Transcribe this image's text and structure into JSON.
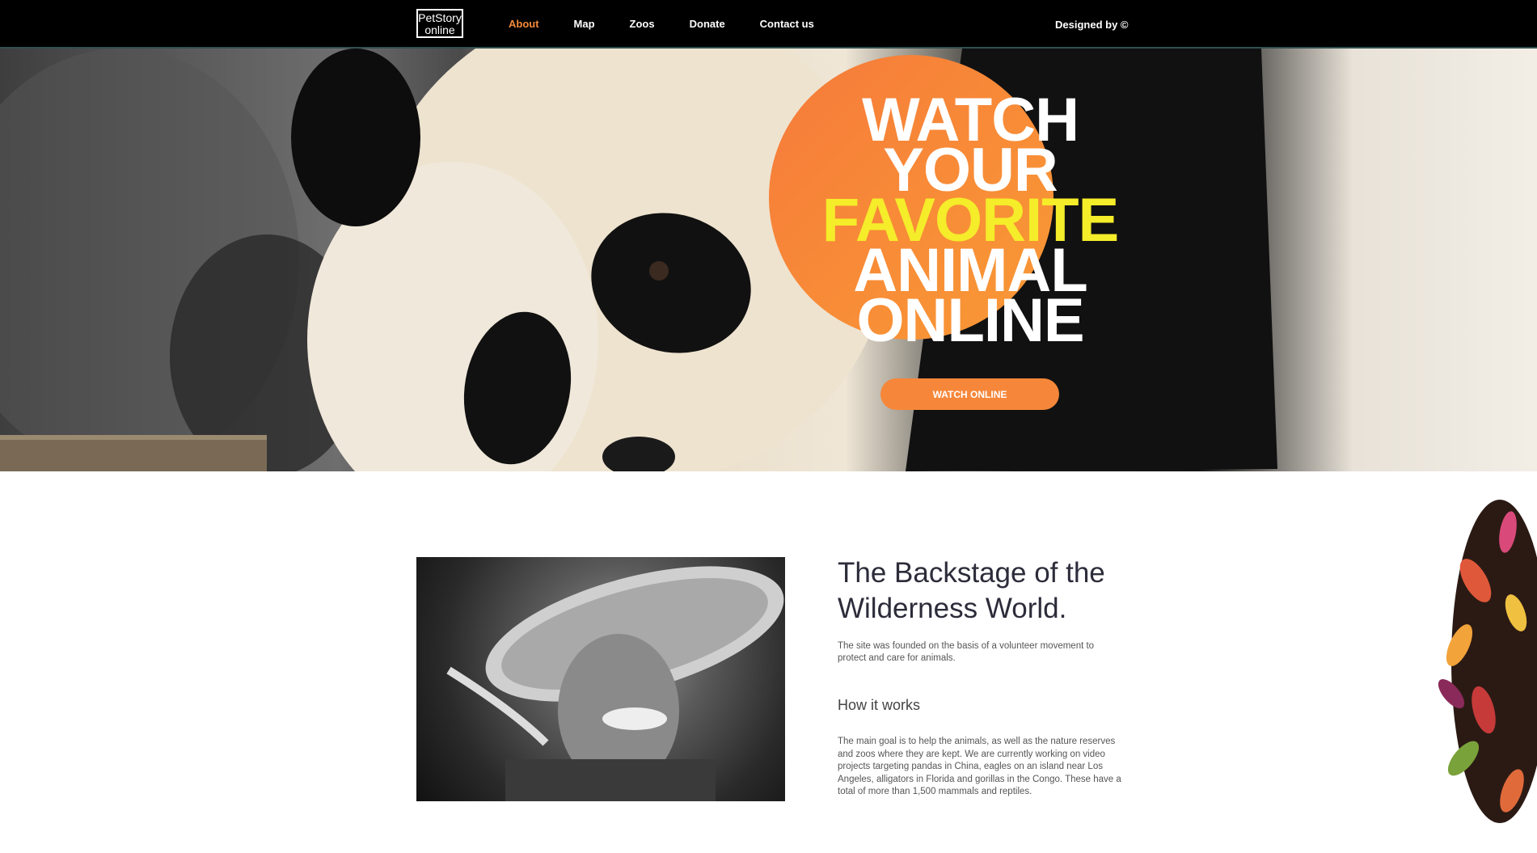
{
  "nav": {
    "logo_line1": "PetStory",
    "logo_line2": "online",
    "links": [
      {
        "label": "About",
        "active": true
      },
      {
        "label": "Map",
        "active": false
      },
      {
        "label": "Zoos",
        "active": false
      },
      {
        "label": "Donate",
        "active": false
      },
      {
        "label": "Contact us",
        "active": false
      }
    ],
    "designed_by": "Designed by ©"
  },
  "hero": {
    "headline_lines": [
      "WATCH",
      "YOUR",
      "FAVORITE",
      "ANIMAL",
      "ONLINE"
    ],
    "highlight_word": "FAVORITE",
    "button_label": "WATCH ONLINE",
    "accent_color": "#f6873a",
    "highlight_color": "#f5ec2a"
  },
  "about": {
    "title": "The Backstage of the Wilderness World.",
    "intro": "The site was founded on the basis of a volunteer movement to protect and care for animals.",
    "subheading": "How it works",
    "body": "The main goal is to help the animals, as well as the nature reserves and zoos where they are kept. We are currently working on video projects targeting pandas in China, eagles on an island near Los Angeles, alligators in Florida and gorillas in the Congo. These have a total of more than 1,500 mammals and reptiles."
  }
}
